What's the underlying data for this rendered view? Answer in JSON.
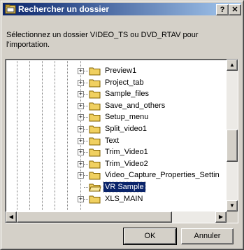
{
  "window": {
    "title": "Rechercher un dossier",
    "help_label": "?",
    "close_label": "✕"
  },
  "instruction": "Sélectionnez un dossier VIDEO_TS ou DVD_RTAV pour l'importation.",
  "tree": {
    "items": [
      {
        "label": "Preview1",
        "has_expander": true,
        "selected": false
      },
      {
        "label": "Project_tab",
        "has_expander": true,
        "selected": false
      },
      {
        "label": "Sample_files",
        "has_expander": true,
        "selected": false
      },
      {
        "label": "Save_and_others",
        "has_expander": true,
        "selected": false
      },
      {
        "label": "Setup_menu",
        "has_expander": true,
        "selected": false
      },
      {
        "label": "Split_video1",
        "has_expander": true,
        "selected": false
      },
      {
        "label": "Text",
        "has_expander": true,
        "selected": false
      },
      {
        "label": "Trim_Video1",
        "has_expander": true,
        "selected": false
      },
      {
        "label": "Trim_Video2",
        "has_expander": true,
        "selected": false
      },
      {
        "label": "Video_Capture_Properties_Settin",
        "has_expander": true,
        "selected": false
      },
      {
        "label": "VR Sample",
        "has_expander": false,
        "selected": true
      },
      {
        "label": "XLS_MAIN",
        "has_expander": true,
        "selected": false
      }
    ],
    "expander_symbol": "+"
  },
  "buttons": {
    "ok": "OK",
    "cancel": "Annuler"
  },
  "colors": {
    "titlebar_start": "#0a246a",
    "titlebar_end": "#a6caf0",
    "selection": "#0a246a",
    "folder": "#f0d060"
  }
}
